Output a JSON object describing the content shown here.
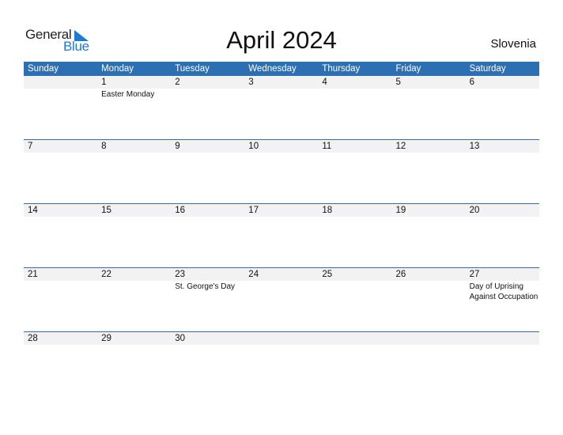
{
  "logo": {
    "word1": "General",
    "word2": "Blue"
  },
  "header": {
    "title": "April 2024",
    "country": "Slovenia"
  },
  "weekdays": [
    "Sunday",
    "Monday",
    "Tuesday",
    "Wednesday",
    "Thursday",
    "Friday",
    "Saturday"
  ],
  "weeks": [
    [
      {
        "day": ""
      },
      {
        "day": "1",
        "holiday": "Easter Monday"
      },
      {
        "day": "2"
      },
      {
        "day": "3"
      },
      {
        "day": "4"
      },
      {
        "day": "5"
      },
      {
        "day": "6"
      }
    ],
    [
      {
        "day": "7"
      },
      {
        "day": "8"
      },
      {
        "day": "9"
      },
      {
        "day": "10"
      },
      {
        "day": "11"
      },
      {
        "day": "12"
      },
      {
        "day": "13"
      }
    ],
    [
      {
        "day": "14"
      },
      {
        "day": "15"
      },
      {
        "day": "16"
      },
      {
        "day": "17"
      },
      {
        "day": "18"
      },
      {
        "day": "19"
      },
      {
        "day": "20"
      }
    ],
    [
      {
        "day": "21"
      },
      {
        "day": "22"
      },
      {
        "day": "23",
        "holiday": "St. George's Day"
      },
      {
        "day": "24"
      },
      {
        "day": "25"
      },
      {
        "day": "26"
      },
      {
        "day": "27",
        "holiday": "Day of Uprising Against Occupation"
      }
    ],
    [
      {
        "day": "28"
      },
      {
        "day": "29"
      },
      {
        "day": "30"
      },
      {
        "day": ""
      },
      {
        "day": ""
      },
      {
        "day": ""
      },
      {
        "day": ""
      }
    ]
  ],
  "colors": {
    "accent": "#2d6fb3",
    "logo_blue": "#1f7ad1",
    "band": "#f2f2f2"
  }
}
